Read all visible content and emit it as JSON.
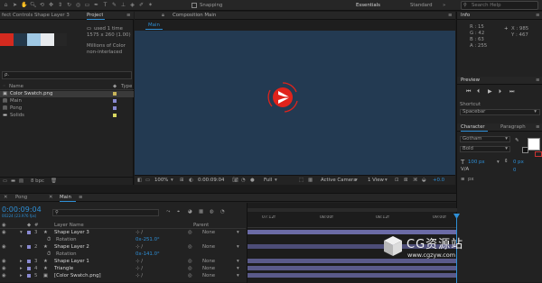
{
  "toolbar": {
    "snapping_label": "Snapping",
    "workspace_essentials": "Essentials",
    "workspace_standard": "Standard",
    "search_placeholder": "Search Help"
  },
  "effect_controls": {
    "title": "fect Controls Shape Layer 3"
  },
  "project": {
    "title": "Project",
    "comp_info": "used 1 time",
    "dims": "1575 x 260 (1.00)",
    "colors_info": "Millions of Color",
    "interlace": "non-interlaced",
    "swatches": [
      "#d42a1f",
      "#23384a",
      "#9fc8e4",
      "#e8ebee",
      "#262626"
    ],
    "search_icon_text": "ρ.",
    "name_header": "Name",
    "type_header": "Type",
    "items": [
      {
        "name": "Color Swatch.png",
        "icon": "image-icon"
      },
      {
        "name": "Main",
        "icon": "composition-icon"
      },
      {
        "name": "Pong",
        "icon": "composition-icon"
      },
      {
        "name": "Solids",
        "icon": "folder-icon"
      }
    ],
    "bpc": "8 bpc"
  },
  "composition": {
    "title": "Composition Main",
    "tab": "Main",
    "zoom": "100%",
    "timecode": "0:00:09:04",
    "resolution": "Full",
    "camera": "Active Camera",
    "view": "1 View",
    "exposure": "+0.0"
  },
  "info": {
    "title": "Info",
    "R": "R : 15",
    "G": "G : 42",
    "B": "B : 63",
    "A": "A : 255",
    "X": "X : 985",
    "Y": "Y : 467"
  },
  "preview": {
    "title": "Preview"
  },
  "shortcut": {
    "label": "Shortcut",
    "value": "Spacebar"
  },
  "character": {
    "tab_character": "Character",
    "tab_paragraph": "Paragraph",
    "font": "Gotham",
    "style": "Bold",
    "size": "100 px",
    "kerning": "0 px",
    "tracking": "0",
    "stroke": "px"
  },
  "timeline": {
    "tabs": [
      "Pong",
      "Main"
    ],
    "timecode": "0:00:09:04",
    "frame": "00224 (23.976 fps)",
    "col_layer_name": "Layer Name",
    "col_parent": "Parent",
    "ruler": [
      "07:12f",
      "08:00f",
      "08:12f",
      "09:00f",
      "09:12f"
    ],
    "layers": [
      {
        "num": "3",
        "name": "Shape Layer 3",
        "parent": "None",
        "color": "#8a8ad2"
      },
      {
        "sub": "Rotation",
        "value": "0x-251.0°"
      },
      {
        "num": "2",
        "name": "Shape Layer 2",
        "parent": "None",
        "color": "#8a8ad2"
      },
      {
        "sub": "Rotation",
        "value": "0x-141.0°"
      },
      {
        "num": "3",
        "name": "Shape Layer 1",
        "parent": "None",
        "color": "#8a8ad2"
      },
      {
        "num": "4",
        "name": "Triangle",
        "parent": "None",
        "color": "#8a8ad2"
      },
      {
        "num": "5",
        "name": "[Color Swatch.png]",
        "parent": "None",
        "color": "#8a8ad2"
      }
    ]
  },
  "watermark": {
    "brand": "CG资源站",
    "url": "www.cgzyw.com"
  },
  "colors": {
    "accent": "#2e8fd6",
    "comp_bg": "#233a52",
    "logo_red": "#e0231b"
  }
}
